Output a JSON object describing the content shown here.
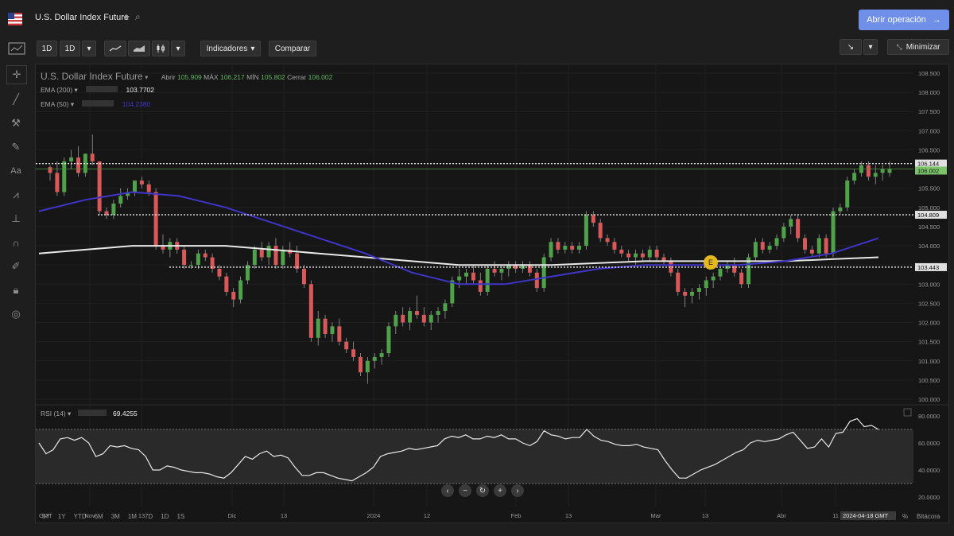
{
  "header": {
    "title": "U.S. Dollar Index Future",
    "open_button": "Abrir operación",
    "open_arrow": "→",
    "minimize": "Minimizar",
    "star": "★",
    "magnifier": "⌕"
  },
  "toolbar": {
    "interval_a": "1D",
    "interval_b": "1D",
    "indicators": "Indicadores",
    "compare": "Comparar",
    "drawing_select": "↘",
    "caret": "▾"
  },
  "legend": {
    "symbol": "U.S. Dollar Index Future",
    "open_label": "Abrir",
    "open": "105.909",
    "high_label": "MÁX",
    "high": "106.217",
    "low_label": "MÍN",
    "low": "105.802",
    "close_label": "Cerrar",
    "close": "106.002",
    "ema200_label": "EMA (200)",
    "ema200_value": "103.7702",
    "ema50_label": "EMA (50)",
    "ema50_value": "104.2380"
  },
  "rsi": {
    "label": "RSI (14)",
    "value": "69.4255",
    "axis": [
      "80.0000",
      "60.0000",
      "40.0000",
      "20.0000"
    ]
  },
  "price_axis": [
    "108.500",
    "108.000",
    "107.500",
    "107.000",
    "106.500",
    "106.000",
    "105.500",
    "105.000",
    "104.500",
    "104.000",
    "103.500",
    "103.000",
    "102.500",
    "102.000",
    "101.500",
    "101.000",
    "100.500",
    "100.000"
  ],
  "price_tags": [
    {
      "value": "106.144",
      "color": "#e0e0e0"
    },
    {
      "value": "106.002",
      "color": "#7cc46a"
    },
    {
      "value": "104.809",
      "color": "#e0e0e0"
    },
    {
      "value": "103.443",
      "color": "#e0e0e0"
    }
  ],
  "time_axis": {
    "tz": "GMT",
    "labels": [
      "Nov",
      "13",
      "Dic",
      "13",
      "2024",
      "12",
      "Feb",
      "13",
      "Mar",
      "13",
      "Abr",
      "11"
    ],
    "cursor_date": "2024-04-18 GMT"
  },
  "timeframes": [
    "5Y",
    "1Y",
    "YTD",
    "6M",
    "3M",
    "1M",
    "7D",
    "1D",
    "1S"
  ],
  "bottom_right": {
    "percent": "%",
    "log": "Bitácora"
  },
  "event_marker": "E",
  "nav_buttons": [
    "‹",
    "−",
    "↻",
    "+",
    "›"
  ],
  "chart_data": {
    "type": "candlestick",
    "title": "U.S. Dollar Index Future",
    "ylim": [
      100.0,
      108.5
    ],
    "horizontal_levels": [
      106.144,
      104.809,
      103.443
    ],
    "series": [
      {
        "name": "EMA (200)",
        "color": "#e8e8e8"
      },
      {
        "name": "EMA (50)",
        "color": "#3f35c8"
      }
    ],
    "ema200": [
      103.8,
      103.9,
      104.0,
      104.0,
      104.0,
      103.9,
      103.8,
      103.7,
      103.6,
      103.5,
      103.5,
      103.5,
      103.55,
      103.6,
      103.6,
      103.6,
      103.6,
      103.65,
      103.7
    ],
    "ema50": [
      104.9,
      105.2,
      105.4,
      105.3,
      105.0,
      104.6,
      104.2,
      103.8,
      103.3,
      103.0,
      103.0,
      103.2,
      103.4,
      103.5,
      103.5,
      103.5,
      103.6,
      103.8,
      104.2
    ],
    "candles": [
      [
        106.05,
        106.1,
        105.7,
        105.9
      ],
      [
        105.9,
        106.2,
        105.3,
        105.4
      ],
      [
        105.4,
        106.3,
        105.3,
        106.2
      ],
      [
        106.2,
        106.5,
        106.0,
        106.3
      ],
      [
        106.3,
        106.6,
        105.8,
        105.9
      ],
      [
        105.9,
        106.4,
        105.8,
        106.4
      ],
      [
        106.4,
        106.9,
        106.1,
        106.2
      ],
      [
        106.2,
        106.2,
        104.8,
        104.9
      ],
      [
        104.9,
        105.0,
        104.7,
        104.8
      ],
      [
        104.8,
        105.2,
        104.7,
        105.1
      ],
      [
        105.1,
        105.5,
        105.0,
        105.3
      ],
      [
        105.3,
        105.5,
        105.2,
        105.4
      ],
      [
        105.4,
        105.7,
        105.3,
        105.7
      ],
      [
        105.7,
        105.8,
        105.5,
        105.6
      ],
      [
        105.6,
        105.7,
        105.3,
        105.4
      ],
      [
        105.4,
        105.5,
        103.9,
        104.0
      ],
      [
        104.0,
        104.3,
        103.8,
        103.9
      ],
      [
        103.9,
        104.2,
        103.7,
        104.1
      ],
      [
        104.1,
        104.2,
        103.8,
        103.9
      ],
      [
        103.9,
        104.0,
        103.4,
        103.5
      ],
      [
        103.5,
        103.6,
        103.4,
        103.5
      ],
      [
        103.5,
        103.9,
        103.4,
        103.8
      ],
      [
        103.8,
        103.9,
        103.6,
        103.7
      ],
      [
        103.7,
        103.8,
        103.3,
        103.4
      ],
      [
        103.4,
        103.5,
        103.1,
        103.2
      ],
      [
        103.2,
        103.3,
        102.7,
        102.8
      ],
      [
        102.8,
        102.9,
        102.4,
        102.6
      ],
      [
        102.6,
        103.2,
        102.5,
        103.1
      ],
      [
        103.1,
        103.6,
        103.0,
        103.5
      ],
      [
        103.5,
        104.0,
        103.4,
        103.9
      ],
      [
        103.9,
        104.1,
        103.6,
        103.7
      ],
      [
        103.7,
        104.1,
        103.5,
        104.0
      ],
      [
        104.0,
        104.2,
        103.4,
        103.5
      ],
      [
        103.5,
        104.0,
        103.4,
        103.9
      ],
      [
        103.9,
        104.1,
        103.7,
        103.8
      ],
      [
        103.8,
        104.0,
        103.3,
        103.4
      ],
      [
        103.4,
        103.5,
        102.9,
        103.0
      ],
      [
        103.0,
        103.1,
        101.5,
        101.6
      ],
      [
        101.6,
        102.3,
        101.4,
        102.1
      ],
      [
        102.1,
        102.2,
        101.6,
        101.7
      ],
      [
        101.7,
        102.0,
        101.5,
        101.9
      ],
      [
        101.9,
        102.1,
        101.4,
        101.5
      ],
      [
        101.5,
        101.6,
        101.2,
        101.3
      ],
      [
        101.3,
        101.5,
        101.0,
        101.1
      ],
      [
        101.1,
        101.2,
        100.6,
        100.7
      ],
      [
        100.7,
        101.1,
        100.4,
        101.0
      ],
      [
        101.0,
        101.2,
        100.8,
        101.1
      ],
      [
        101.1,
        101.3,
        100.9,
        101.2
      ],
      [
        101.2,
        102.0,
        101.1,
        101.9
      ],
      [
        101.9,
        102.3,
        101.7,
        102.2
      ],
      [
        102.2,
        102.4,
        101.9,
        102.0
      ],
      [
        102.0,
        102.4,
        101.8,
        102.3
      ],
      [
        102.3,
        102.7,
        102.1,
        102.2
      ],
      [
        102.2,
        102.4,
        101.9,
        102.0
      ],
      [
        102.0,
        102.3,
        101.8,
        102.2
      ],
      [
        102.2,
        102.4,
        102.0,
        102.3
      ],
      [
        102.3,
        102.6,
        102.1,
        102.5
      ],
      [
        102.5,
        103.2,
        102.4,
        103.1
      ],
      [
        103.1,
        103.4,
        102.9,
        103.2
      ],
      [
        103.2,
        103.4,
        103.0,
        103.3
      ],
      [
        103.3,
        103.5,
        103.0,
        103.1
      ],
      [
        103.1,
        103.3,
        102.7,
        102.8
      ],
      [
        102.8,
        103.5,
        102.7,
        103.4
      ],
      [
        103.4,
        103.6,
        103.2,
        103.3
      ],
      [
        103.3,
        103.5,
        103.1,
        103.4
      ],
      [
        103.4,
        103.6,
        103.2,
        103.5
      ],
      [
        103.5,
        103.6,
        103.3,
        103.4
      ],
      [
        103.4,
        103.6,
        103.3,
        103.5
      ],
      [
        103.5,
        103.6,
        103.2,
        103.3
      ],
      [
        103.3,
        103.4,
        102.8,
        102.9
      ],
      [
        102.9,
        103.8,
        102.8,
        103.7
      ],
      [
        103.7,
        104.2,
        103.6,
        104.1
      ],
      [
        104.1,
        104.2,
        103.8,
        103.9
      ],
      [
        103.9,
        104.1,
        103.8,
        104.0
      ],
      [
        104.0,
        104.1,
        103.8,
        103.9
      ],
      [
        103.9,
        104.1,
        103.8,
        104.0
      ],
      [
        104.0,
        104.9,
        103.9,
        104.8
      ],
      [
        104.8,
        104.9,
        104.5,
        104.6
      ],
      [
        104.6,
        104.7,
        104.1,
        104.2
      ],
      [
        104.2,
        104.3,
        104.0,
        104.1
      ],
      [
        104.1,
        104.2,
        103.8,
        103.9
      ],
      [
        103.9,
        104.0,
        103.7,
        103.8
      ],
      [
        103.8,
        103.9,
        103.6,
        103.7
      ],
      [
        103.7,
        103.9,
        103.5,
        103.8
      ],
      [
        103.8,
        103.9,
        103.6,
        103.7
      ],
      [
        103.7,
        104.0,
        103.6,
        103.9
      ],
      [
        103.9,
        104.0,
        103.6,
        103.7
      ],
      [
        103.7,
        103.8,
        103.5,
        103.6
      ],
      [
        103.6,
        103.7,
        103.2,
        103.3
      ],
      [
        103.3,
        103.4,
        102.7,
        102.8
      ],
      [
        102.8,
        102.9,
        102.4,
        102.7
      ],
      [
        102.7,
        102.9,
        102.5,
        102.8
      ],
      [
        102.8,
        103.0,
        102.6,
        102.9
      ],
      [
        102.9,
        103.2,
        102.7,
        103.1
      ],
      [
        103.1,
        103.3,
        102.9,
        103.2
      ],
      [
        103.2,
        103.5,
        103.1,
        103.4
      ],
      [
        103.4,
        103.6,
        103.3,
        103.5
      ],
      [
        103.5,
        103.7,
        103.2,
        103.3
      ],
      [
        103.3,
        103.4,
        102.9,
        103.0
      ],
      [
        103.0,
        103.8,
        102.9,
        103.7
      ],
      [
        103.7,
        104.2,
        103.6,
        104.1
      ],
      [
        104.1,
        104.2,
        103.8,
        103.9
      ],
      [
        103.9,
        104.1,
        103.8,
        104.0
      ],
      [
        104.0,
        104.3,
        103.9,
        104.2
      ],
      [
        104.2,
        104.6,
        104.1,
        104.5
      ],
      [
        104.5,
        104.8,
        104.3,
        104.7
      ],
      [
        104.7,
        104.8,
        104.1,
        104.2
      ],
      [
        104.2,
        104.3,
        103.8,
        103.9
      ],
      [
        103.9,
        104.0,
        103.7,
        103.8
      ],
      [
        103.8,
        104.3,
        103.7,
        104.2
      ],
      [
        104.2,
        104.3,
        103.7,
        103.8
      ],
      [
        103.8,
        105.0,
        103.7,
        104.9
      ],
      [
        104.9,
        105.1,
        104.8,
        105.0
      ],
      [
        105.0,
        105.8,
        104.9,
        105.7
      ],
      [
        105.7,
        106.0,
        105.6,
        105.9
      ],
      [
        105.9,
        106.2,
        105.8,
        106.1
      ],
      [
        106.1,
        106.2,
        105.7,
        105.8
      ],
      [
        105.8,
        106.1,
        105.6,
        105.9
      ],
      [
        105.9,
        106.1,
        105.7,
        106.0
      ],
      [
        105.9,
        106.2,
        105.8,
        106.0
      ]
    ],
    "rsi_values": [
      60,
      52,
      55,
      63,
      64,
      62,
      64,
      60,
      50,
      52,
      58,
      57,
      58,
      56,
      55,
      50,
      40,
      40,
      43,
      42,
      40,
      39,
      38,
      38,
      37,
      35,
      34,
      38,
      44,
      50,
      48,
      52,
      54,
      50,
      51,
      49,
      42,
      36,
      36,
      38,
      38,
      36,
      34,
      33,
      32,
      35,
      38,
      42,
      50,
      52,
      53,
      54,
      56,
      55,
      56,
      57,
      58,
      63,
      65,
      64,
      66,
      63,
      63,
      65,
      64,
      66,
      63,
      63,
      60,
      58,
      61,
      69,
      66,
      65,
      63,
      64,
      64,
      70,
      65,
      62,
      61,
      59,
      58,
      58,
      59,
      57,
      56,
      55,
      47,
      40,
      34,
      34,
      37,
      40,
      42,
      44,
      47,
      50,
      53,
      55,
      60,
      62,
      61,
      62,
      63,
      66,
      68,
      62,
      56,
      57,
      63,
      57,
      67,
      68,
      76,
      78,
      72,
      73,
      70
    ]
  }
}
